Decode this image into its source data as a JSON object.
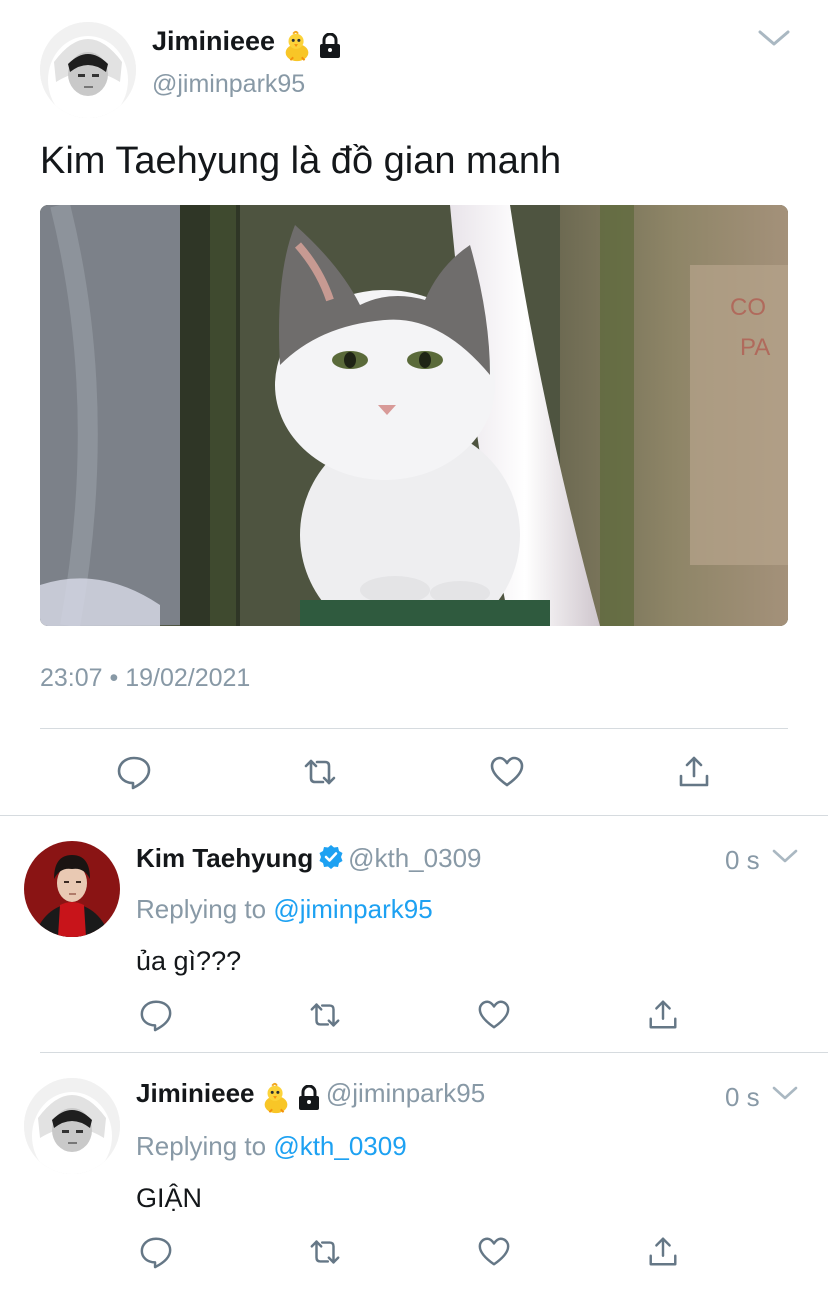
{
  "tweet": {
    "author_name": "Jiminieee",
    "author_handle": "@jiminpark95",
    "text": "Kim Taehyung là đồ gian manh",
    "timestamp": "23:07 • 19/02/2021"
  },
  "replies": [
    {
      "author_name": "Kim Taehyung",
      "author_handle": "@kth_0309",
      "time": "0 s",
      "replying_prefix": "Replying to ",
      "replying_to": "@jiminpark95",
      "text": "ủa gì???"
    },
    {
      "author_name": "Jiminieee",
      "author_handle": "@jiminpark95",
      "time": "0 s",
      "replying_prefix": "Replying to ",
      "replying_to": "@kth_0309",
      "text": "GIẬN"
    }
  ],
  "icons": {
    "chick": "baby-chick-emoji",
    "lock": "lock-icon",
    "verified": "verified-badge-icon",
    "menu": "chevron-down-icon",
    "reply": "reply-icon",
    "retweet": "retweet-icon",
    "like": "heart-icon",
    "share": "share-icon"
  },
  "colors": {
    "text": "#14171a",
    "secondary": "#8899a6",
    "link": "#1da1f2",
    "divider": "#d6dbdf",
    "verified": "#1da1f2"
  }
}
